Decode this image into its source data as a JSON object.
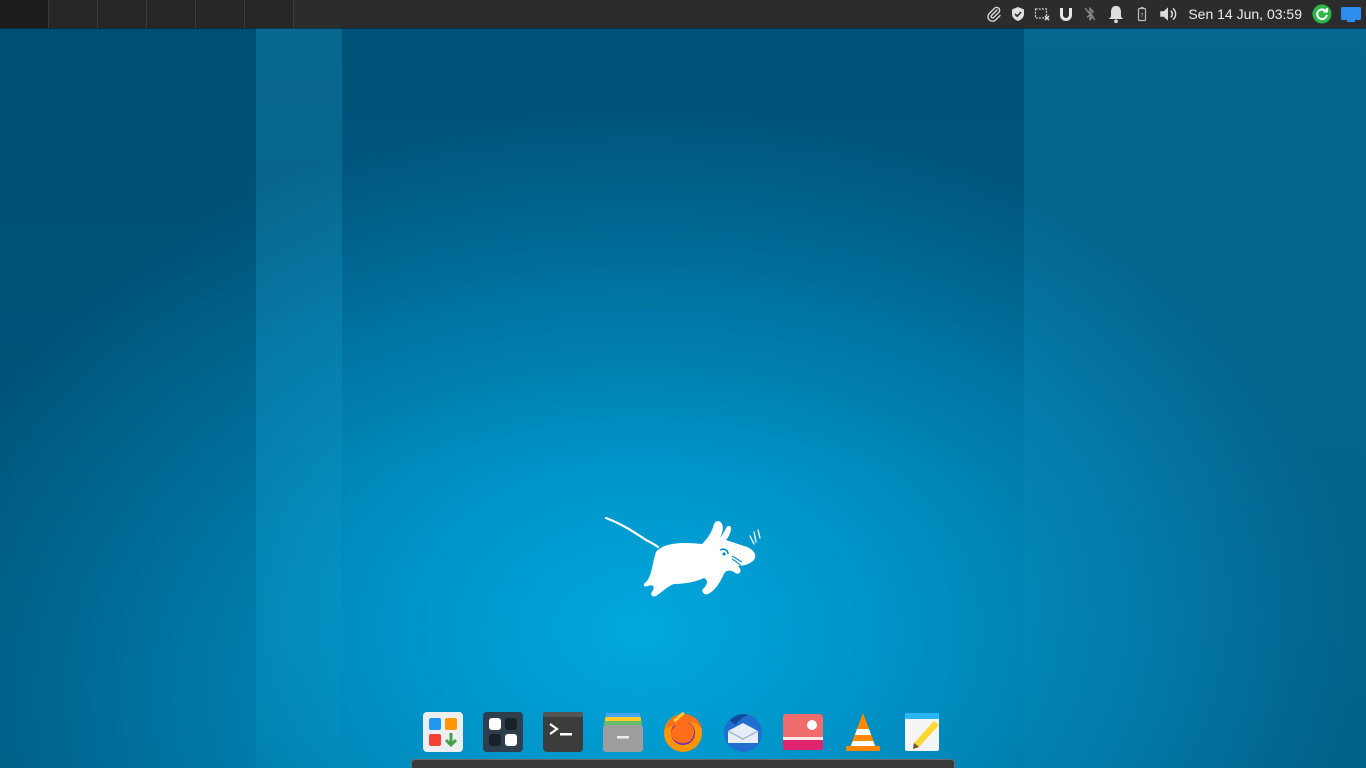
{
  "panel": {
    "workspaces": [
      "workspace-1",
      "workspace-2",
      "workspace-3",
      "workspace-4",
      "workspace-5",
      "workspace-6"
    ],
    "active_workspace": 1,
    "tray_icons": [
      "paperclip-icon",
      "shield-icon",
      "screenshot-icon",
      "magnet-icon",
      "bluetooth-off-icon",
      "bell-icon",
      "battery-icon",
      "volume-icon"
    ],
    "clock": "Sen 14 Jun, 03:59",
    "update_icon": "update-icon",
    "show-desktop_icon": "show-desktop-icon"
  },
  "dock": {
    "items": [
      {
        "name": "software-center-icon"
      },
      {
        "name": "app-grid-icon"
      },
      {
        "name": "terminal-icon"
      },
      {
        "name": "file-manager-icon"
      },
      {
        "name": "firefox-icon"
      },
      {
        "name": "thunderbird-icon"
      },
      {
        "name": "image-viewer-icon"
      },
      {
        "name": "vlc-icon"
      },
      {
        "name": "text-editor-icon"
      }
    ]
  },
  "colors": {
    "panel_bg": "#2c2c2c",
    "wallpaper_center": "#00a8de",
    "wallpaper_edge": "#005e86",
    "update_green": "#2fb84a",
    "desktop_blue": "#2f8cef"
  }
}
